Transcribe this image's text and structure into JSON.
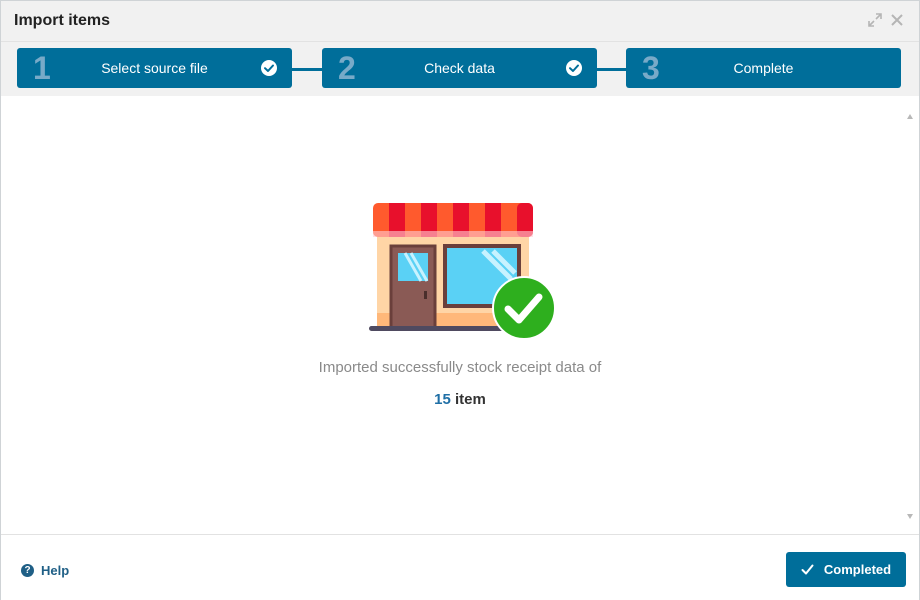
{
  "dialog": {
    "title": "Import items"
  },
  "titlebar": {
    "expand_icon": "expand-icon",
    "close_icon": "close-icon"
  },
  "steps": [
    {
      "number": "1",
      "label": "Select source file",
      "done": true
    },
    {
      "number": "2",
      "label": "Check data",
      "done": true
    },
    {
      "number": "3",
      "label": "Complete",
      "done": false
    }
  ],
  "result": {
    "message": "Imported successfully stock receipt data of",
    "count": "15",
    "unit": "item",
    "illustration_icon": "storefront-success-icon"
  },
  "footer": {
    "help_label": "Help",
    "help_icon": "question-circle-icon",
    "completed_label": "Completed",
    "completed_icon": "check-icon"
  },
  "colors": {
    "primary": "#006e9a",
    "step_number": "#78aac8",
    "count": "#1f6fa6",
    "help": "#1f5f86",
    "success": "#2eaf1e"
  }
}
